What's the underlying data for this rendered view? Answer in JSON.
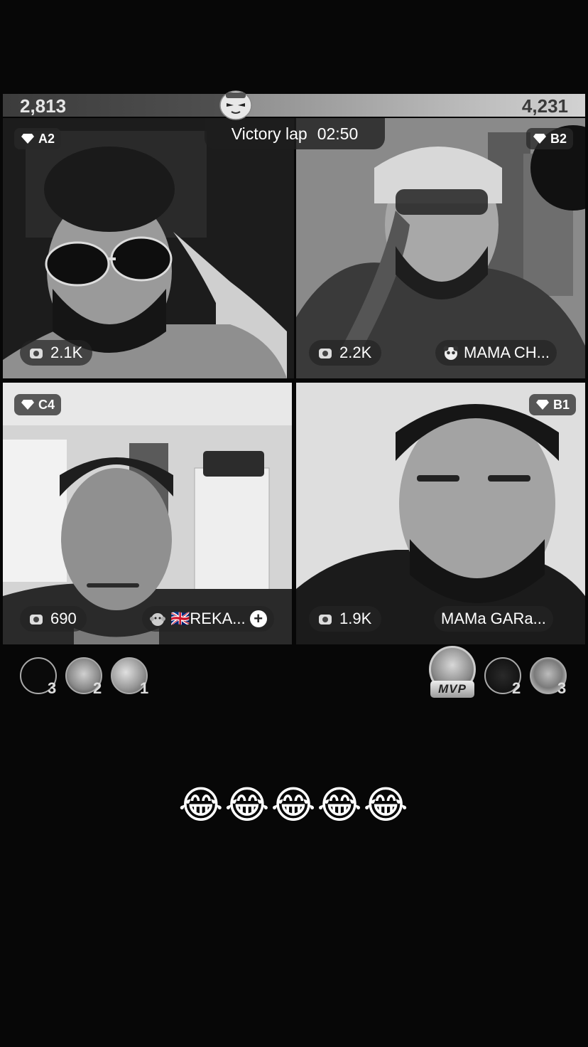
{
  "battle": {
    "score_left": "2,813",
    "score_right": "4,231",
    "status_label": "Victory lap",
    "timer": "02:50"
  },
  "tiles": [
    {
      "badge": "A2",
      "stat": "2.1K",
      "name": ""
    },
    {
      "badge": "B2",
      "stat": "2.2K",
      "name": "MAMA CH..."
    },
    {
      "badge": "C4",
      "stat": "690",
      "name": "🇬🇧REKA..."
    },
    {
      "badge": "B1",
      "stat": "1.9K",
      "name": "MAMa GARa..."
    }
  ],
  "left_ranking": [
    {
      "rank": "3"
    },
    {
      "rank": "2"
    },
    {
      "rank": "1"
    }
  ],
  "right_ranking": {
    "mvp_label": "MVP",
    "items": [
      {
        "rank": "2"
      },
      {
        "rank": "3"
      }
    ]
  },
  "comment": "😂😂😂😂😂",
  "icons": [
    "diamond-icon",
    "camera-icon",
    "panda-icon",
    "plus-icon",
    "mascot-icon"
  ]
}
